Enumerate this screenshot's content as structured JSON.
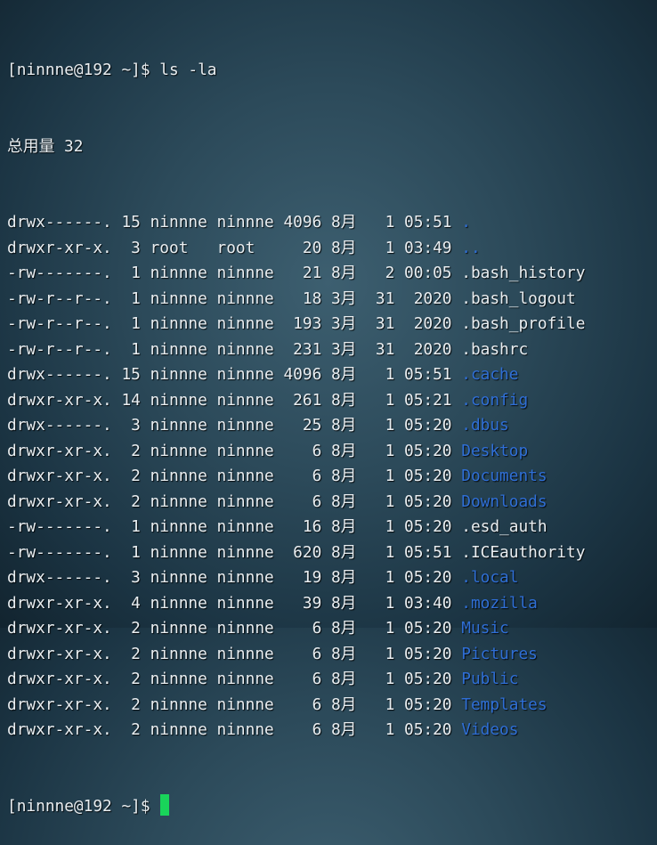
{
  "colors": {
    "text": "#e9eef1",
    "directory": "#2f6fd6",
    "cursor": "#19d45a"
  },
  "terminal": {
    "prompt_line": "[ninnne@192 ~]$ ls -la",
    "total_line": "总用量 32",
    "entries": [
      {
        "perm": "drwx------.",
        "links": "15",
        "owner": "ninnne",
        "group": "ninnne",
        "size": "4096",
        "month": "8月",
        "day": "1",
        "time": "05:51",
        "name": ".",
        "dir": true
      },
      {
        "perm": "drwxr-xr-x.",
        "links": "3",
        "owner": "root",
        "group": "root",
        "size": "20",
        "month": "8月",
        "day": "1",
        "time": "03:49",
        "name": "..",
        "dir": true
      },
      {
        "perm": "-rw-------.",
        "links": "1",
        "owner": "ninnne",
        "group": "ninnne",
        "size": "21",
        "month": "8月",
        "day": "2",
        "time": "00:05",
        "name": ".bash_history",
        "dir": false
      },
      {
        "perm": "-rw-r--r--.",
        "links": "1",
        "owner": "ninnne",
        "group": "ninnne",
        "size": "18",
        "month": "3月",
        "day": "31",
        "time": "2020",
        "name": ".bash_logout",
        "dir": false
      },
      {
        "perm": "-rw-r--r--.",
        "links": "1",
        "owner": "ninnne",
        "group": "ninnne",
        "size": "193",
        "month": "3月",
        "day": "31",
        "time": "2020",
        "name": ".bash_profile",
        "dir": false
      },
      {
        "perm": "-rw-r--r--.",
        "links": "1",
        "owner": "ninnne",
        "group": "ninnne",
        "size": "231",
        "month": "3月",
        "day": "31",
        "time": "2020",
        "name": ".bashrc",
        "dir": false
      },
      {
        "perm": "drwx------.",
        "links": "15",
        "owner": "ninnne",
        "group": "ninnne",
        "size": "4096",
        "month": "8月",
        "day": "1",
        "time": "05:51",
        "name": ".cache",
        "dir": true
      },
      {
        "perm": "drwxr-xr-x.",
        "links": "14",
        "owner": "ninnne",
        "group": "ninnne",
        "size": "261",
        "month": "8月",
        "day": "1",
        "time": "05:21",
        "name": ".config",
        "dir": true
      },
      {
        "perm": "drwx------.",
        "links": "3",
        "owner": "ninnne",
        "group": "ninnne",
        "size": "25",
        "month": "8月",
        "day": "1",
        "time": "05:20",
        "name": ".dbus",
        "dir": true
      },
      {
        "perm": "drwxr-xr-x.",
        "links": "2",
        "owner": "ninnne",
        "group": "ninnne",
        "size": "6",
        "month": "8月",
        "day": "1",
        "time": "05:20",
        "name": "Desktop",
        "dir": true
      },
      {
        "perm": "drwxr-xr-x.",
        "links": "2",
        "owner": "ninnne",
        "group": "ninnne",
        "size": "6",
        "month": "8月",
        "day": "1",
        "time": "05:20",
        "name": "Documents",
        "dir": true
      },
      {
        "perm": "drwxr-xr-x.",
        "links": "2",
        "owner": "ninnne",
        "group": "ninnne",
        "size": "6",
        "month": "8月",
        "day": "1",
        "time": "05:20",
        "name": "Downloads",
        "dir": true
      },
      {
        "perm": "-rw-------.",
        "links": "1",
        "owner": "ninnne",
        "group": "ninnne",
        "size": "16",
        "month": "8月",
        "day": "1",
        "time": "05:20",
        "name": ".esd_auth",
        "dir": false
      },
      {
        "perm": "-rw-------.",
        "links": "1",
        "owner": "ninnne",
        "group": "ninnne",
        "size": "620",
        "month": "8月",
        "day": "1",
        "time": "05:51",
        "name": ".ICEauthority",
        "dir": false
      },
      {
        "perm": "drwx------.",
        "links": "3",
        "owner": "ninnne",
        "group": "ninnne",
        "size": "19",
        "month": "8月",
        "day": "1",
        "time": "05:20",
        "name": ".local",
        "dir": true
      },
      {
        "perm": "drwxr-xr-x.",
        "links": "4",
        "owner": "ninnne",
        "group": "ninnne",
        "size": "39",
        "month": "8月",
        "day": "1",
        "time": "03:40",
        "name": ".mozilla",
        "dir": true
      },
      {
        "perm": "drwxr-xr-x.",
        "links": "2",
        "owner": "ninnne",
        "group": "ninnne",
        "size": "6",
        "month": "8月",
        "day": "1",
        "time": "05:20",
        "name": "Music",
        "dir": true
      },
      {
        "perm": "drwxr-xr-x.",
        "links": "2",
        "owner": "ninnne",
        "group": "ninnne",
        "size": "6",
        "month": "8月",
        "day": "1",
        "time": "05:20",
        "name": "Pictures",
        "dir": true
      },
      {
        "perm": "drwxr-xr-x.",
        "links": "2",
        "owner": "ninnne",
        "group": "ninnne",
        "size": "6",
        "month": "8月",
        "day": "1",
        "time": "05:20",
        "name": "Public",
        "dir": true
      },
      {
        "perm": "drwxr-xr-x.",
        "links": "2",
        "owner": "ninnne",
        "group": "ninnne",
        "size": "6",
        "month": "8月",
        "day": "1",
        "time": "05:20",
        "name": "Templates",
        "dir": true
      },
      {
        "perm": "drwxr-xr-x.",
        "links": "2",
        "owner": "ninnne",
        "group": "ninnne",
        "size": "6",
        "month": "8月",
        "day": "1",
        "time": "05:20",
        "name": "Videos",
        "dir": true
      }
    ],
    "final_prompt": "[ninnne@192 ~]$"
  }
}
